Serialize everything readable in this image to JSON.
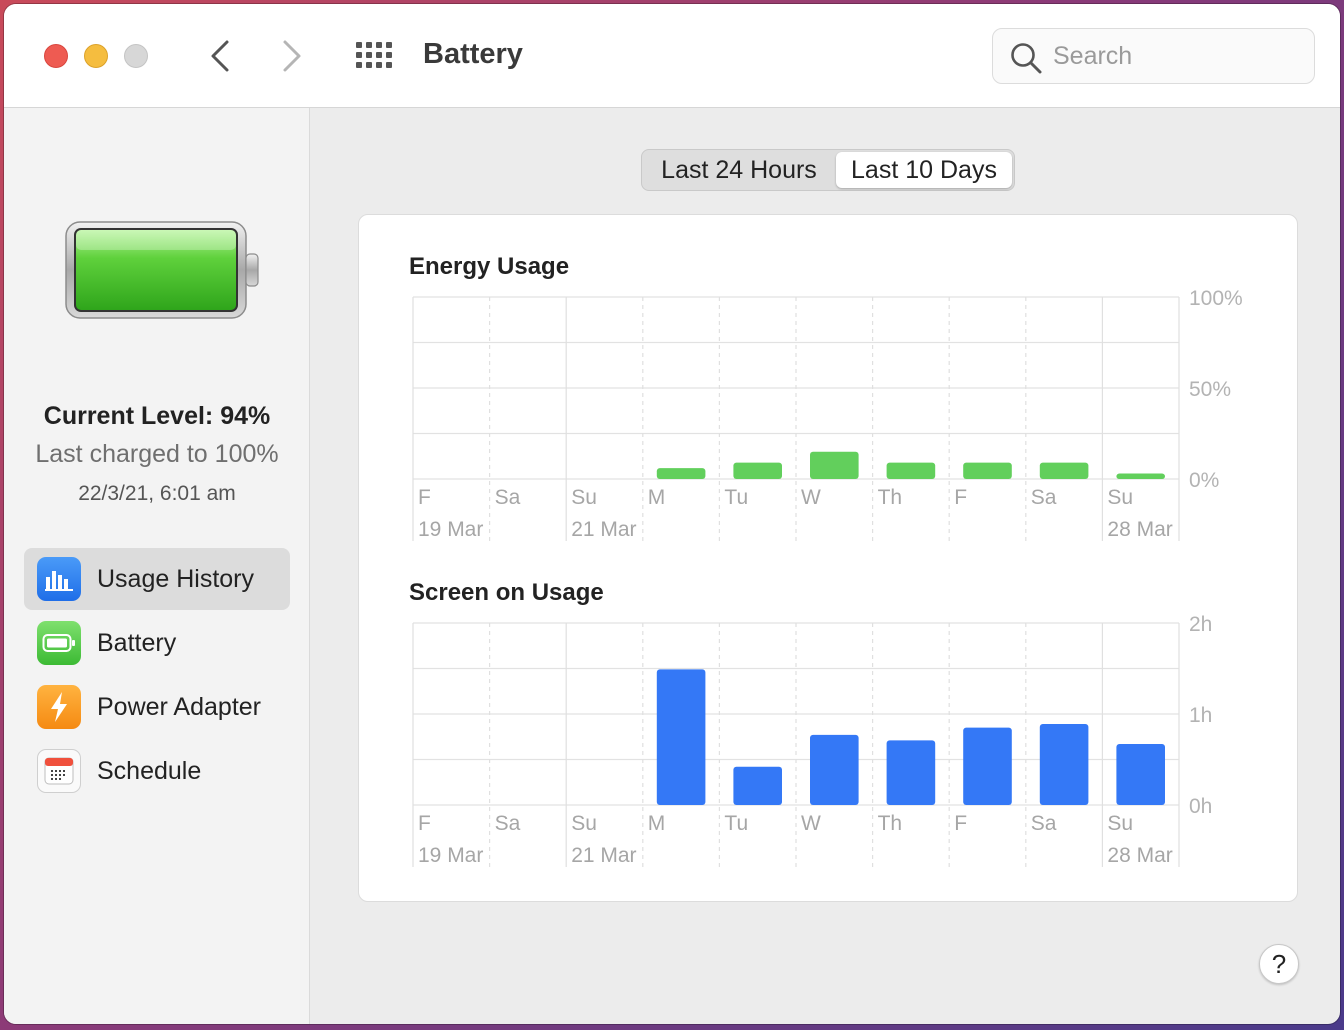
{
  "window": {
    "title": "Battery"
  },
  "search": {
    "placeholder": "Search"
  },
  "sidebar": {
    "current_level": "Current Level: 94%",
    "last_charged": "Last charged to 100%",
    "charged_time": "22/3/21, 6:01 am",
    "items": [
      {
        "label": "Usage History",
        "icon": "usage-history-icon",
        "active": true
      },
      {
        "label": "Battery",
        "icon": "battery-icon",
        "active": false
      },
      {
        "label": "Power Adapter",
        "icon": "power-adapter-icon",
        "active": false
      },
      {
        "label": "Schedule",
        "icon": "schedule-icon",
        "active": false
      }
    ]
  },
  "segments": {
    "left": "Last 24 Hours",
    "right": "Last 10 Days",
    "selected": "Last 10 Days"
  },
  "help": {
    "label": "?"
  },
  "colors": {
    "energy_bar": "#62cf5c",
    "screen_bar": "#3478f6",
    "battery_fill": "#5fd13c"
  },
  "chart_data": [
    {
      "type": "bar",
      "title": "Energy Usage",
      "categories": [
        "F",
        "Sa",
        "Su",
        "M",
        "Tu",
        "W",
        "Th",
        "F",
        "Sa",
        "Su"
      ],
      "date_labels": [
        "19 Mar",
        "",
        "21 Mar",
        "",
        "",
        "",
        "",
        "",
        "",
        "28 Mar"
      ],
      "values": [
        0,
        0,
        0,
        6,
        9,
        15,
        9,
        9,
        9,
        3
      ],
      "yticks": [
        "100%",
        "50%",
        "0%"
      ],
      "ylim": [
        0,
        100
      ],
      "grid": true
    },
    {
      "type": "bar",
      "title": "Screen on Usage",
      "categories": [
        "F",
        "Sa",
        "Su",
        "M",
        "Tu",
        "W",
        "Th",
        "F",
        "Sa",
        "Su"
      ],
      "date_labels": [
        "19 Mar",
        "",
        "21 Mar",
        "",
        "",
        "",
        "",
        "",
        "",
        "28 Mar"
      ],
      "values": [
        0,
        0,
        0,
        1.49,
        0.42,
        0.77,
        0.71,
        0.85,
        0.89,
        0.67
      ],
      "yticks": [
        "2h",
        "1h",
        "0h"
      ],
      "ylim": [
        0,
        2
      ],
      "grid": true
    }
  ]
}
